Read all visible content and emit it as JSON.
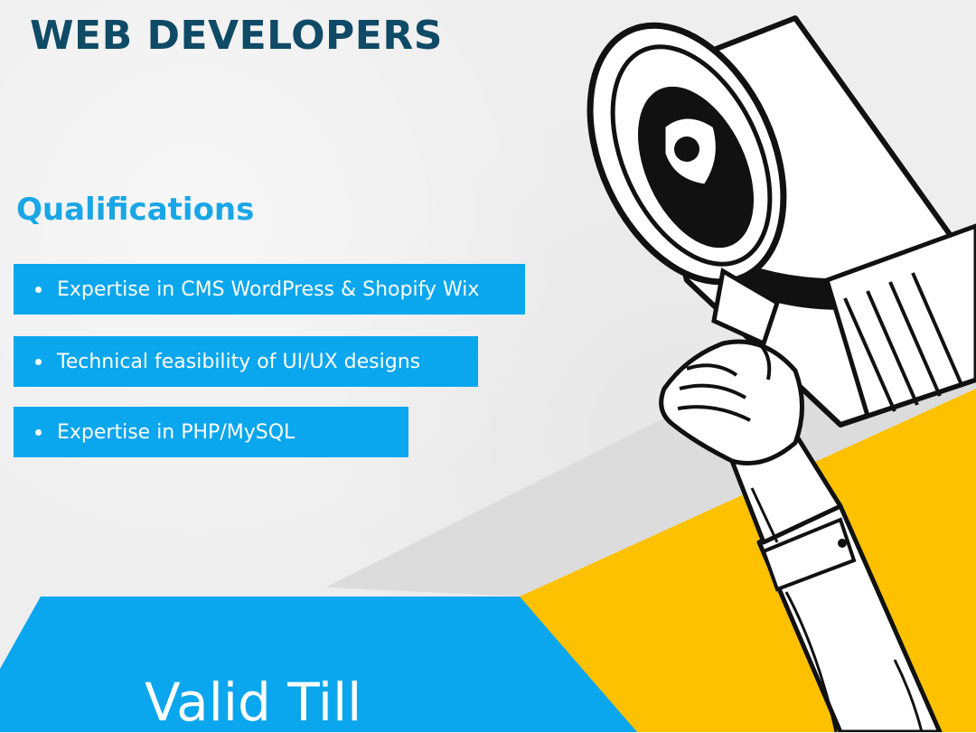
{
  "header": {
    "title": "WEB DEVELOPERS"
  },
  "qualifications": {
    "heading": "Qualifications",
    "items": [
      "Expertise in CMS WordPress & Shopify Wix",
      "Technical feasibility of UI/UX designs",
      "Expertise in PHP/MySQL"
    ]
  },
  "footer": {
    "valid_label": "Valid Till"
  },
  "colors": {
    "title": "#0f4a66",
    "accent_blue": "#0aa6ee",
    "accent_yellow": "#fdc100",
    "background": "#eeeeee"
  },
  "icons": {
    "illustration": "megaphone-icon"
  }
}
